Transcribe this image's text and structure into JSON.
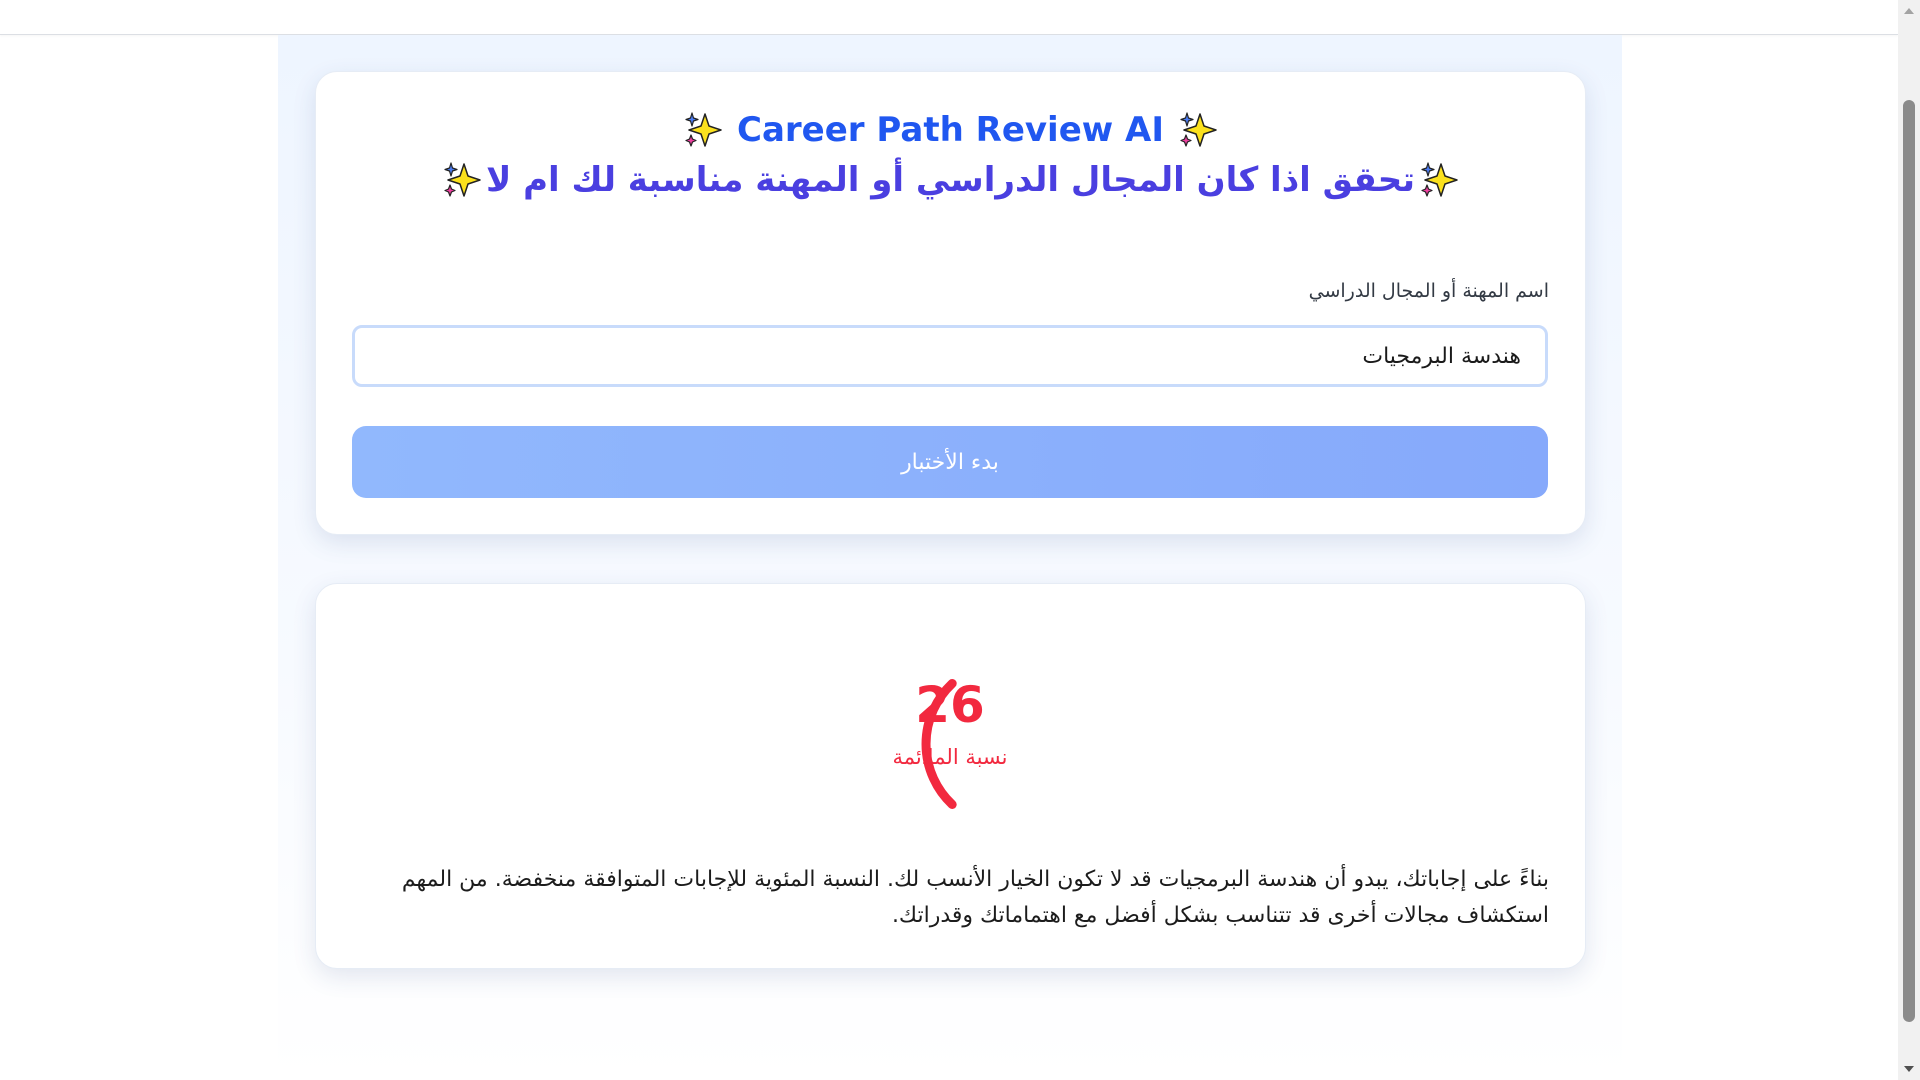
{
  "header": {
    "title_en": "Career Path Review AI",
    "title_ar": "تحقق اذا كان المجال الدراسي أو المهنة مناسبة لك ام لا"
  },
  "form": {
    "label": "اسم المهنة أو المجال الدراسي",
    "input_value": "هندسة البرمجيات",
    "start_button": "بدء الأختبار"
  },
  "result": {
    "score": "26",
    "score_fraction": 0.26,
    "score_label": "نسبة الملائمة",
    "description": "بناءً على إجاباتك، يبدو أن هندسة البرمجيات قد لا تكون الخيار الأنسب لك. النسبة المئوية للإجابات المتوافقة منخفضة. من المهم استكشاف مجالات أخرى قد تتناسب بشكل أفضل مع اهتماماتك وقدراتك."
  },
  "colors": {
    "title_en": "#2057f0",
    "title_ar": "#4a3fe0",
    "button": "#8fb3fd",
    "score": "#f2293f"
  },
  "icons": [
    "sparkles-icon"
  ]
}
